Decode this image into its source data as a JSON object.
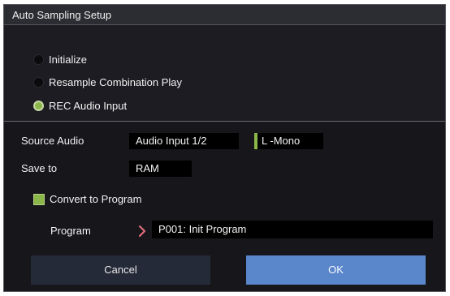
{
  "dialog": {
    "title": "Auto Sampling Setup",
    "mode_options": [
      {
        "label": "Initialize",
        "selected": false
      },
      {
        "label": "Resample Combination Play",
        "selected": false
      },
      {
        "label": "REC Audio Input",
        "selected": true
      }
    ],
    "source_audio": {
      "label": "Source Audio",
      "input_value": "Audio Input 1/2",
      "channel_value": "L -Mono"
    },
    "save_to": {
      "label": "Save to",
      "value": "RAM"
    },
    "convert": {
      "label": "Convert to Program",
      "checked": true
    },
    "program": {
      "label": "Program",
      "value": "P001: Init Program"
    },
    "buttons": {
      "cancel": "Cancel",
      "ok": "OK"
    },
    "colors": {
      "accent_green": "#8ab64a",
      "ok_blue": "#5a86cc",
      "chevron_pink": "#e06b7a"
    }
  }
}
